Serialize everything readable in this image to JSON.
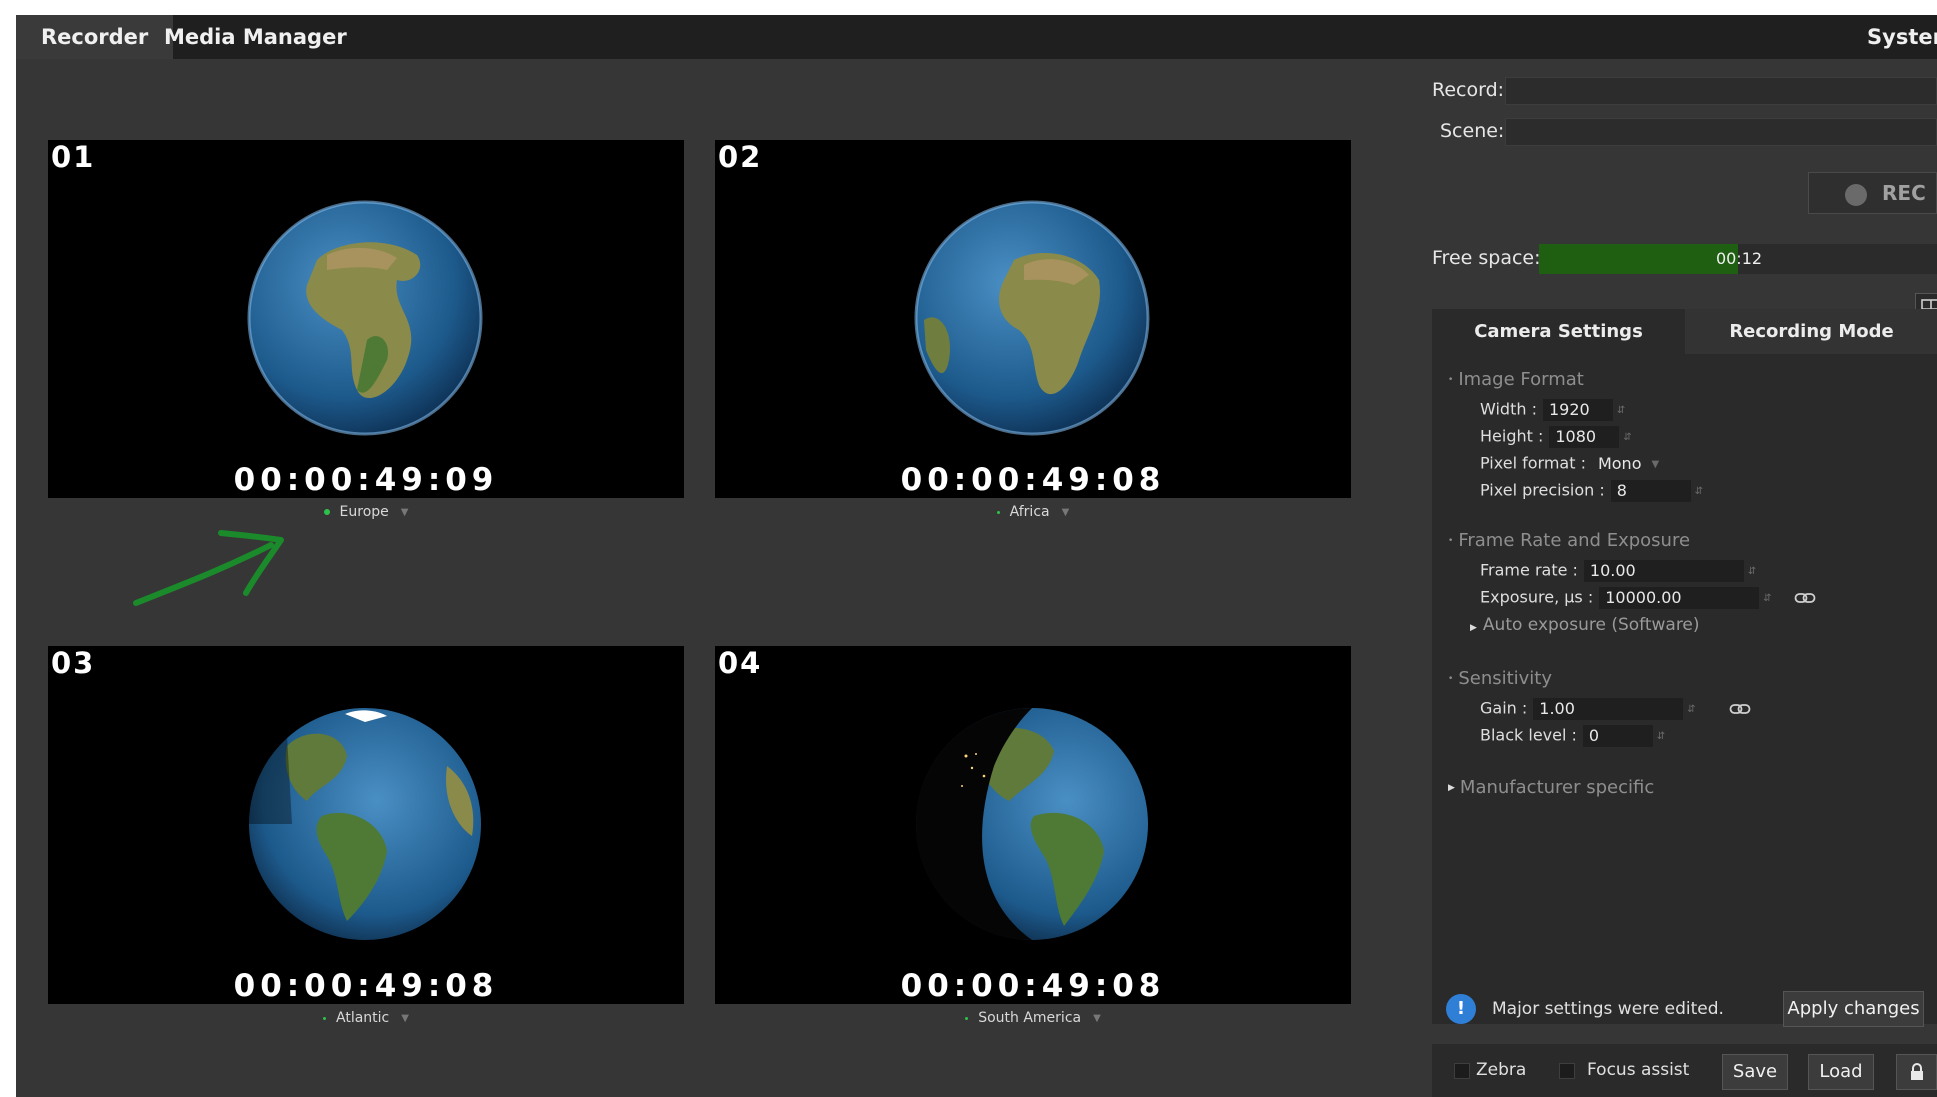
{
  "tabs": {
    "recorder": "Recorder",
    "media_manager": "Media Manager",
    "system": "System"
  },
  "cameras": [
    {
      "number": "01",
      "timecode": "00:00:49:09",
      "name": "Europe"
    },
    {
      "number": "02",
      "timecode": "00:00:49:08",
      "name": "Africa"
    },
    {
      "number": "03",
      "timecode": "00:00:49:08",
      "name": "Atlantic"
    },
    {
      "number": "04",
      "timecode": "00:00:49:08",
      "name": "South America"
    }
  ],
  "recording": {
    "record_label": "Record:",
    "record_value": "",
    "scene_label": "Scene:",
    "scene_value": "",
    "rec_button": "REC",
    "free_space_label": "Free space:",
    "free_space_value": "00:12",
    "free_space_fraction": 0.5
  },
  "settings": {
    "tab_camera": "Camera Settings",
    "tab_recording": "Recording Mode",
    "image_format": {
      "title": "Image Format",
      "width_label": "Width :",
      "width_value": "1920",
      "height_label": "Height :",
      "height_value": "1080",
      "pixel_format_label": "Pixel format :",
      "pixel_format_value": "Mono",
      "pixel_precision_label": "Pixel precision :",
      "pixel_precision_value": "8"
    },
    "frame_rate": {
      "title": "Frame Rate and Exposure",
      "frame_rate_label": "Frame rate :",
      "frame_rate_value": "10.00",
      "exposure_label": "Exposure, μs :",
      "exposure_value": "10000.00",
      "auto_exposure": "Auto exposure (Software)"
    },
    "sensitivity": {
      "title": "Sensitivity",
      "gain_label": "Gain :",
      "gain_value": "1.00",
      "black_level_label": "Black level :",
      "black_level_value": "0"
    },
    "manufacturer": "Manufacturer specific",
    "notice": "Major settings were edited.",
    "apply": "Apply changes"
  },
  "bottom": {
    "zebra": "Zebra",
    "focus_assist": "Focus assist",
    "save": "Save",
    "load": "Load"
  },
  "colors": {
    "accent_green": "#1f5f11",
    "status_dot": "#2ec24a",
    "info_blue": "#2f7fd6",
    "annotation_green": "#1a8a2a"
  },
  "icons": [
    "grid-layout-icon",
    "link-icon",
    "lock-icon",
    "info-icon",
    "record-dot-icon",
    "expand-caret-icon",
    "spin-arrows-icon"
  ]
}
